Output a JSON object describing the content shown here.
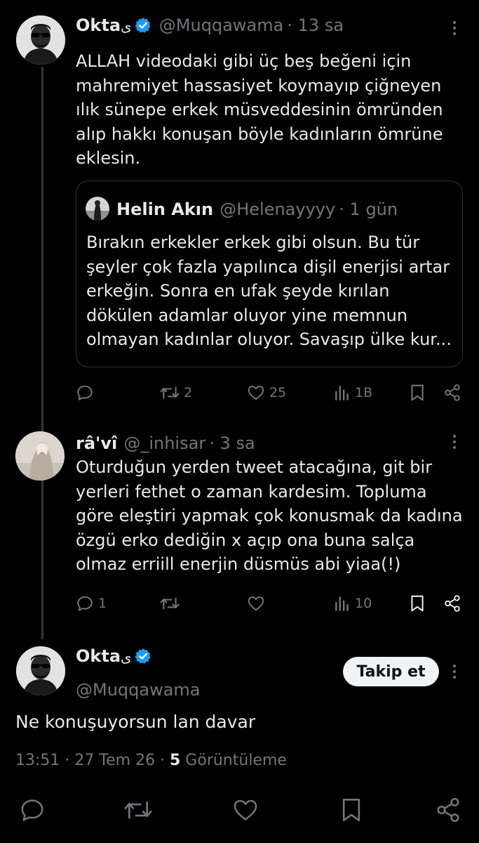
{
  "tweet1": {
    "name": "Okta",
    "name_suffix": "ی",
    "handle": "@Muqqawama",
    "time": "· 13 sa",
    "lines": [
      "ALLAH videodaki gibi üç beş beğeni için",
      "mahremiyet hassasiyet koymayıp çiğneyen",
      "ılık sünepe erkek müsveddesinin ömründen",
      "alıp hakkı konuşan böyle kadınların ömrüne",
      "eklesin."
    ],
    "quote": {
      "name": "Helin Akın",
      "handle": "@Helenayyyy",
      "time": "· 1 gün",
      "lines": [
        "Bırakın erkekler erkek gibi olsun. Bu tür",
        "şeyler çok fazla yapılınca dişil enerjisi artar",
        "erkeğin. Sonra en ufak şeyde kırılan",
        "dökülen adamlar oluyor yine memnun",
        "olmayan kadınlar oluyor. Savaşıp ülke kur..."
      ]
    },
    "actions": {
      "reply": "",
      "retweets": "2",
      "likes": "25",
      "views": "1B"
    }
  },
  "tweet2": {
    "name": "râ'vî",
    "handle": "@_inhisar",
    "time": "· 3 sa",
    "lines": [
      "Oturduğun yerden tweet atacağına, git bir",
      "yerleri fethet o zaman kardesim. Topluma",
      "göre eleştiri yapmak çok konusmak da kadına",
      "özgü erko dediğin x açıp ona buna salça",
      "olmaz erriill enerjin düsmüs abi yiaa(!)"
    ],
    "actions": {
      "reply": "1",
      "retweets": "",
      "likes": "",
      "views": "10"
    }
  },
  "main": {
    "name": "Okta",
    "name_suffix": "ی",
    "handle": "@Muqqawama",
    "follow_label": "Takip et",
    "text": "Ne konuşuyorsun lan davar",
    "time": "13:51 · 27 Tem 26 · ",
    "views_count": "5",
    "views_label": " Görüntüleme"
  },
  "colors": {
    "background": "#000000",
    "text": "#e7e9ea",
    "muted": "#71767b",
    "verified": "#1d9bf0",
    "border": "#2f3336"
  }
}
